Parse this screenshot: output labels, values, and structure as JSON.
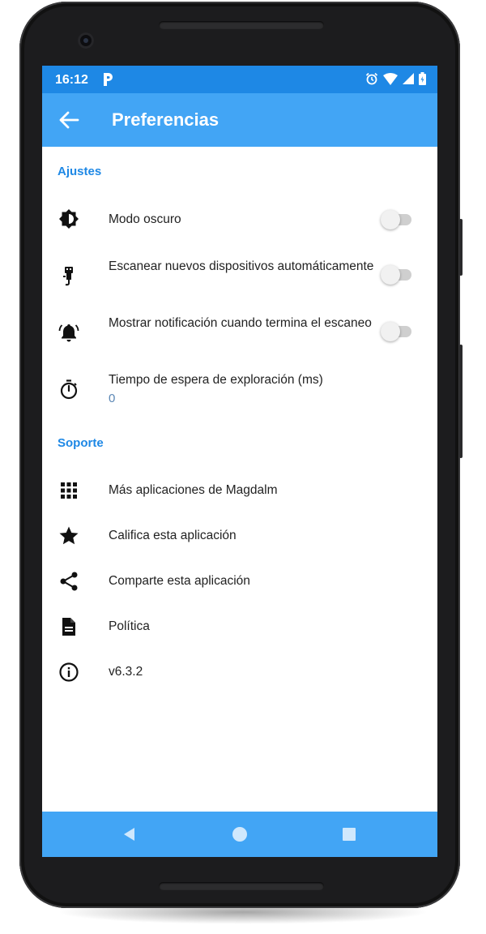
{
  "status_bar": {
    "time": "16:12"
  },
  "app_bar": {
    "title": "Preferencias"
  },
  "sections": {
    "settings": {
      "header": "Ajustes",
      "dark_mode": {
        "label": "Modo oscuro",
        "enabled": false
      },
      "auto_scan": {
        "label": "Escanear nuevos dispositivos automáticamente",
        "enabled": false
      },
      "scan_notification": {
        "label": "Mostrar notificación cuando termina el escaneo",
        "enabled": false
      },
      "scan_timeout": {
        "label": "Tiempo de espera de exploración (ms)",
        "value": "0"
      }
    },
    "support": {
      "header": "Soporte",
      "more_apps": {
        "label": "Más aplicaciones de Magdalm"
      },
      "rate_app": {
        "label": "Califica esta aplicación"
      },
      "share_app": {
        "label": "Comparte esta aplicación"
      },
      "policy": {
        "label": "Política"
      },
      "version": {
        "label": "v6.3.2"
      }
    }
  },
  "icons": {
    "back": "arrow-left-icon",
    "dark_mode": "brightness-contrast-icon",
    "auto_scan": "usb-key-icon",
    "scan_notification": "bell-ringing-icon",
    "scan_timeout": "timer-icon",
    "more_apps": "grid-icon",
    "rate_app": "star-icon",
    "share_app": "share-icon",
    "policy": "document-icon",
    "version": "info-icon"
  },
  "colors": {
    "status_bar": "#1e88e5",
    "app_bar": "#42a5f5",
    "accent": "#1e88e5",
    "value_text": "#5b87b5"
  }
}
